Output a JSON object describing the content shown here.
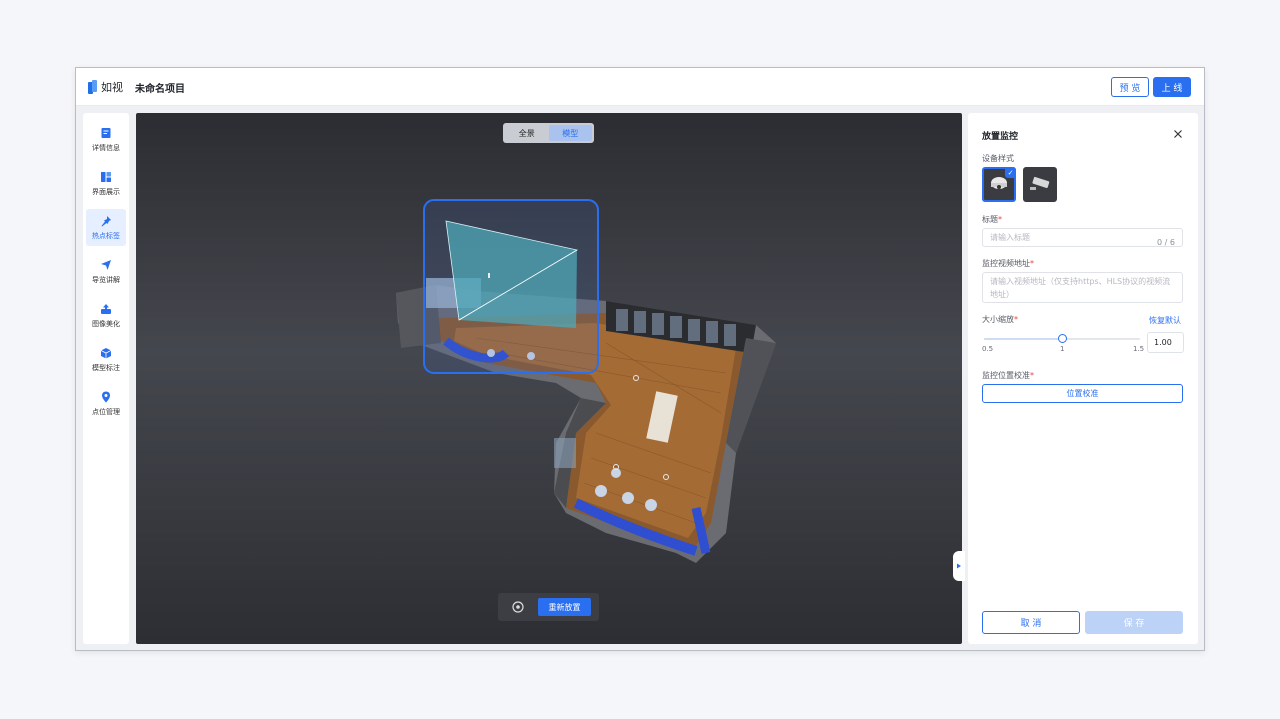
{
  "header": {
    "logo_text": "如视",
    "project_title": "未命名项目",
    "preview_label": "预 览",
    "publish_label": "上 线"
  },
  "sidebar": {
    "items": [
      {
        "label": "详情信息",
        "icon": "document-icon",
        "active": false
      },
      {
        "label": "界面展示",
        "icon": "layout-icon",
        "active": false
      },
      {
        "label": "热点标签",
        "icon": "pin-icon",
        "active": true
      },
      {
        "label": "导览讲解",
        "icon": "send-icon",
        "active": false
      },
      {
        "label": "图像美化",
        "icon": "image-upload-icon",
        "active": false
      },
      {
        "label": "模型标注",
        "icon": "cube-icon",
        "active": false
      },
      {
        "label": "点位管理",
        "icon": "location-icon",
        "active": false
      }
    ]
  },
  "viewer": {
    "view_modes": [
      "全景",
      "模型"
    ],
    "active_view_mode": "模型",
    "replace_label": "重新放置"
  },
  "panel": {
    "title": "放置监控",
    "device_style_label": "设备样式",
    "device_styles": [
      "dome-camera-icon",
      "bullet-camera-icon"
    ],
    "selected_device_style": 0,
    "title_label": "标题",
    "title_placeholder": "请输入标题",
    "title_counter": "0 / 6",
    "video_url_label": "监控视频地址",
    "video_url_placeholder": "请输入视频地址（仅支持https、HLS协议的视频流地址）",
    "scale_label": "大小缩放",
    "restore_default_label": "恢复默认",
    "scale_min": "0.5",
    "scale_mid": "1",
    "scale_max": "1.5",
    "scale_value": "1.00",
    "scale_fraction": 0.5,
    "calibration_label": "监控位置校准",
    "calibration_button": "位置校准",
    "cancel_label": "取 消",
    "save_label": "保 存"
  },
  "colors": {
    "accent": "#2a6ff0",
    "required": "#e5453d",
    "viewer_bg": "#3a3c42"
  }
}
